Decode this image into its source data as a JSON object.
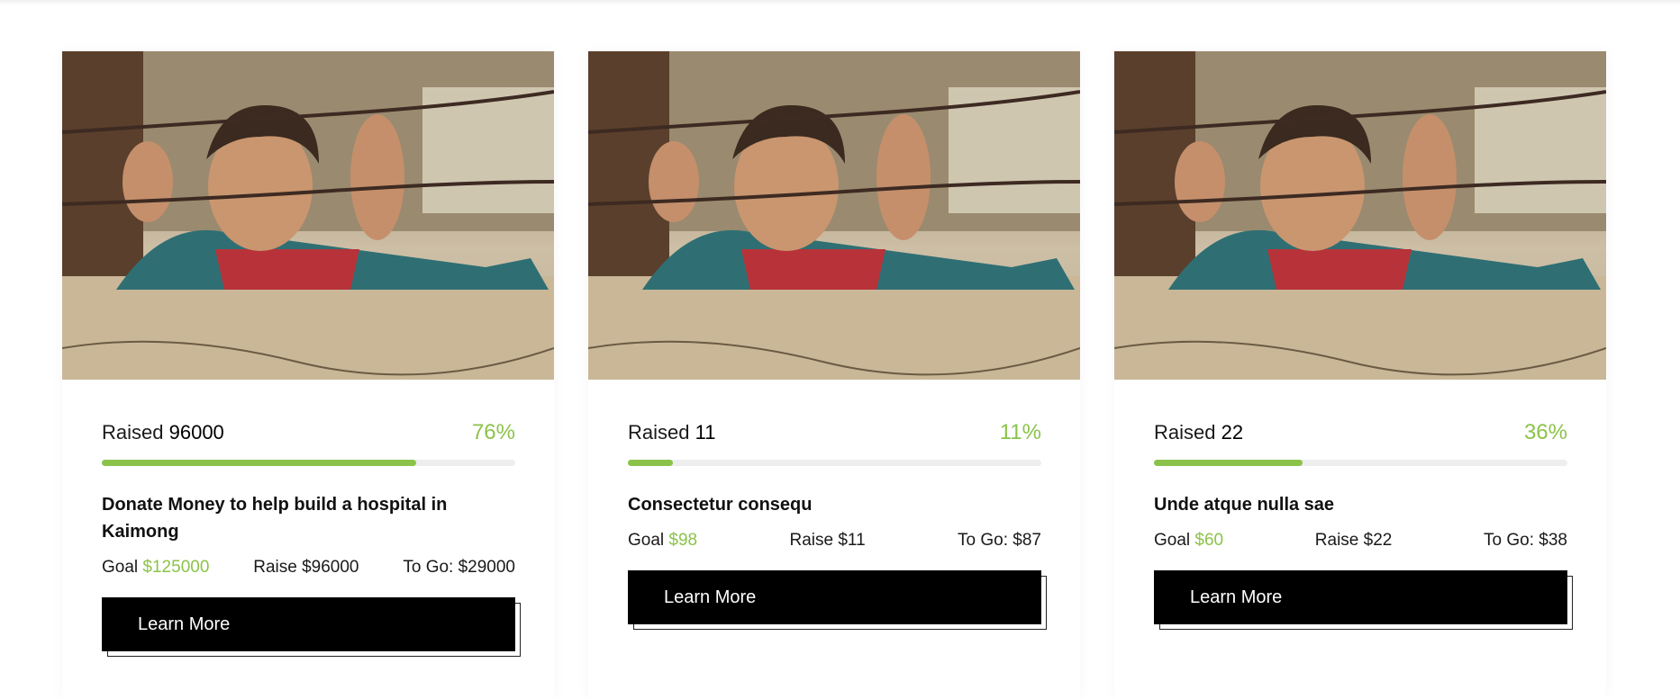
{
  "cards": [
    {
      "raised_label": "Raised",
      "raised_amount": "96000",
      "percent_text": "76%",
      "percent": 76,
      "title": "Donate Money to help build a hospital in Kaimong",
      "goal_label": "Goal",
      "goal_value": "$125000",
      "raise_text": "Raise $96000",
      "togo_text": "To Go: $29000",
      "button_label": "Learn More"
    },
    {
      "raised_label": "Raised",
      "raised_amount": "11",
      "percent_text": "11%",
      "percent": 11,
      "title": "Consectetur consequ",
      "goal_label": "Goal",
      "goal_value": "$98",
      "raise_text": "Raise $11",
      "togo_text": "To Go: $87",
      "button_label": "Learn More"
    },
    {
      "raised_label": "Raised",
      "raised_amount": "22",
      "percent_text": "36%",
      "percent": 36,
      "title": "Unde atque nulla sae",
      "goal_label": "Goal",
      "goal_value": "$60",
      "raise_text": "Raise $22",
      "togo_text": "To Go: $38",
      "button_label": "Learn More"
    }
  ],
  "colors": {
    "accent": "#8bc34a",
    "button_bg": "#000000",
    "track": "#eeeeee"
  },
  "image_icon": "child-behind-barbed-wire-photo"
}
